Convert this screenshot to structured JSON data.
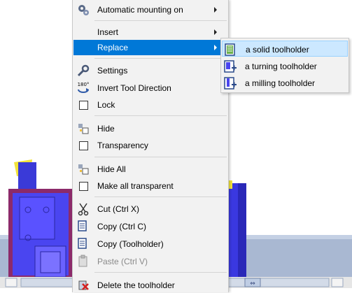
{
  "context_menu": {
    "items": [
      {
        "label": "Automatic mounting on",
        "icon": "gear-icon"
      },
      {
        "label": "Insert"
      },
      {
        "label": "Replace"
      },
      {
        "label": "Settings",
        "icon": "wrench-icon"
      },
      {
        "label": "Invert Tool Direction",
        "icon": "rotate-180-icon",
        "icon_text": "180°"
      },
      {
        "label": "Lock",
        "icon": "checkbox"
      },
      {
        "label": "Hide",
        "icon": "hide-icon"
      },
      {
        "label": "Transparency",
        "icon": "checkbox"
      },
      {
        "label": "Hide All",
        "icon": "hide-all-icon"
      },
      {
        "label": "Make all transparent",
        "icon": "checkbox"
      },
      {
        "label": "Cut (Ctrl X)",
        "icon": "scissors-icon"
      },
      {
        "label": "Copy (Ctrl C)",
        "icon": "copy-icon"
      },
      {
        "label": "Copy (Toolholder)",
        "icon": "copy-icon"
      },
      {
        "label": "Paste (Ctrl V)",
        "icon": "paste-icon",
        "disabled": true
      },
      {
        "label": "Delete the toolholder",
        "icon": "delete-icon"
      }
    ]
  },
  "submenu": {
    "items": [
      {
        "label": "a solid toolholder",
        "icon": "solid-toolholder-icon"
      },
      {
        "label": "a turning toolholder",
        "icon": "turning-toolholder-icon"
      },
      {
        "label": "a milling toolholder",
        "icon": "milling-toolholder-icon"
      }
    ]
  },
  "colors": {
    "menu_bg": "#f2f2f2",
    "highlight": "#0078d7",
    "submenu_highlight": "#cce8ff",
    "machine_blue": "#3a38e0",
    "machine_frame": "#8c2a6a"
  }
}
